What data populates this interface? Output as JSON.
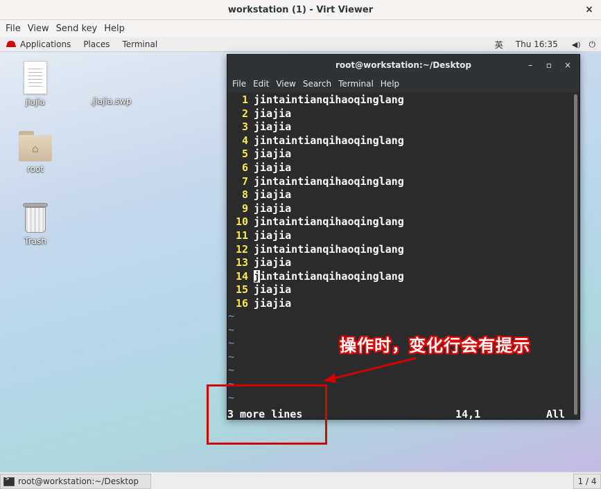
{
  "window": {
    "title": "workstation (1) - Virt Viewer",
    "close": "×"
  },
  "viewer_menu": [
    "File",
    "View",
    "Send key",
    "Help"
  ],
  "panel": {
    "applications": "Applications",
    "places": "Places",
    "terminal": "Terminal",
    "input_method": "英",
    "clock": "Thu 16:35",
    "volume_icon": "◀)",
    "power_icon": "⏻"
  },
  "desktop": {
    "icons": [
      {
        "label": "jiajia",
        "icon": "text-file-icon"
      },
      {
        "label": ".jiajia.swp",
        "icon": "hidden-file"
      },
      {
        "label": "root",
        "icon": "home-folder-icon"
      },
      {
        "label": "Trash",
        "icon": "trash-icon"
      }
    ]
  },
  "terminal": {
    "title": "root@workstation:~/Desktop",
    "controls": {
      "minimize": "–",
      "maximize": "▫",
      "close": "×"
    },
    "menu": [
      "File",
      "Edit",
      "View",
      "Search",
      "Terminal",
      "Help"
    ],
    "lines": [
      {
        "num": "1",
        "text": "jintaintianqihaoqinglang"
      },
      {
        "num": "2",
        "text": "jiajia"
      },
      {
        "num": "3",
        "text": "jiajia"
      },
      {
        "num": "4",
        "text": "jintaintianqihaoqinglang"
      },
      {
        "num": "5",
        "text": "jiajia"
      },
      {
        "num": "6",
        "text": "jiajia"
      },
      {
        "num": "7",
        "text": "jintaintianqihaoqinglang"
      },
      {
        "num": "8",
        "text": "jiajia"
      },
      {
        "num": "9",
        "text": "jiajia"
      },
      {
        "num": "10",
        "text": "jintaintianqihaoqinglang"
      },
      {
        "num": "11",
        "text": "jiajia"
      },
      {
        "num": "12",
        "text": "jintaintianqihaoqinglang"
      },
      {
        "num": "13",
        "text": "jiajia"
      },
      {
        "num": "14",
        "text": "jintaintianqihaoqinglang",
        "cursor": true
      },
      {
        "num": "15",
        "text": "jiajia"
      },
      {
        "num": "16",
        "text": "jiajia"
      }
    ],
    "tilde_count": 7,
    "status": {
      "message": "3 more lines",
      "position": "14,1",
      "scroll": "All"
    }
  },
  "annotation": {
    "text": "操作时，变化行会有提示",
    "color": "#e00000"
  },
  "taskbar": {
    "task_label": "root@workstation:~/Desktop",
    "workspace": "1 / 4"
  }
}
